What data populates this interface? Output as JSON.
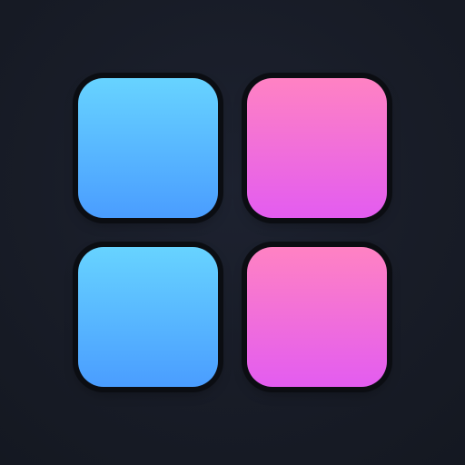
{
  "app_icon": {
    "name": "grid-app-icon",
    "background_color": "#181c27",
    "tiles": [
      {
        "name": "top-left-tile",
        "color_top": "#67d3ff",
        "color_bottom": "#4a9dff"
      },
      {
        "name": "top-right-tile",
        "color_top": "#ff82c3",
        "color_bottom": "#e35cf0"
      },
      {
        "name": "bottom-left-tile",
        "color_top": "#67d3ff",
        "color_bottom": "#4a9dff"
      },
      {
        "name": "bottom-right-tile",
        "color_top": "#ff82c3",
        "color_bottom": "#e35cf0"
      }
    ]
  }
}
